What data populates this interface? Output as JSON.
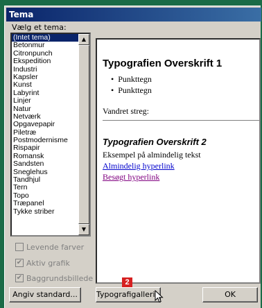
{
  "window": {
    "title": "Tema"
  },
  "theme_list": {
    "label": "Vælg et tema:",
    "selected": "(Intet tema)",
    "items": [
      "(Intet tema)",
      "Betonmur",
      "Citronpunch",
      "Ekspedition",
      "Industri",
      "Kapsler",
      "Kunst",
      "Labyrint",
      "Linjer",
      "Natur",
      "Netværk",
      "Opgavepapir",
      "Piletræ",
      "Postmodernisme",
      "Rispapir",
      "Romansk",
      "Sandsten",
      "Sneglehus",
      "Tandhjul",
      "Tern",
      "Topo",
      "Træpanel",
      "Tykke striber"
    ]
  },
  "options": {
    "vivid_colors": {
      "label": "Levende farver",
      "checked": false
    },
    "active_graphics": {
      "label": "Aktiv grafik",
      "checked": true
    },
    "background_image": {
      "label": "Baggrundsbillede",
      "checked": true
    }
  },
  "preview": {
    "heading1": "Typografien Overskrift 1",
    "bullets": [
      "Punkttegn",
      "Punkttegn"
    ],
    "hr_label": "Vandret streg:",
    "heading2": "Typografien Overskrift 2",
    "body_text": "Eksempel på almindelig tekst",
    "link": "Almindelig hyperlink",
    "visited_link": "Besøgt hyperlink"
  },
  "buttons": {
    "default": "Angiv standard...",
    "gallery": "Typografigalleri...",
    "ok": "OK"
  },
  "callout_badge": "2"
}
